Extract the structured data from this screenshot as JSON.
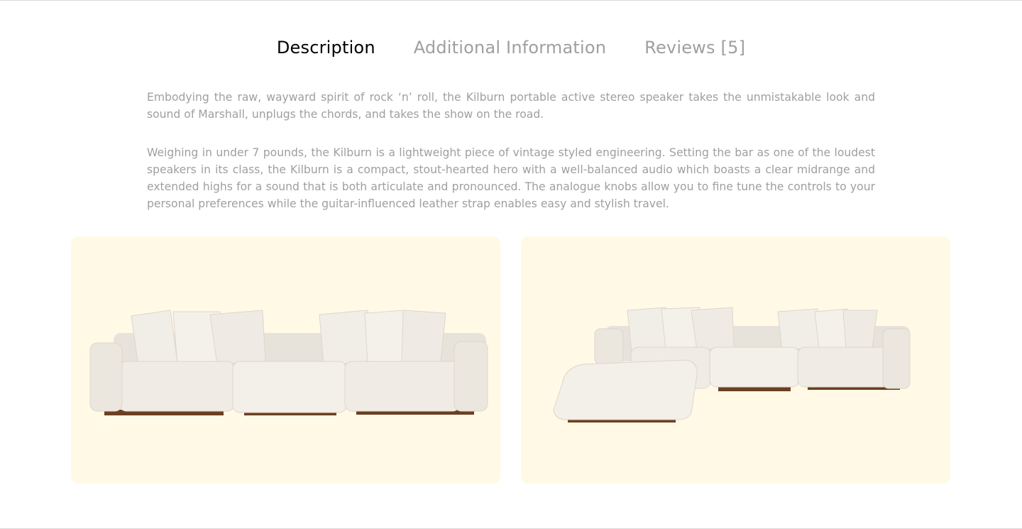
{
  "tabs": [
    {
      "label": "Description",
      "active": true
    },
    {
      "label": "Additional Information",
      "active": false
    },
    {
      "label": "Reviews [5]",
      "active": false
    }
  ],
  "description": {
    "paragraphs": [
      "Embodying the raw, wayward spirit of rock ‘n’ roll, the Kilburn portable active stereo speaker takes the unmistakable look and sound of Marshall, unplugs the chords, and takes the show on the road.",
      "Weighing in under 7 pounds, the Kilburn is a lightweight piece of vintage styled engineering. Setting the bar as one of the loudest speakers in its class, the Kilburn is a compact, stout-hearted hero with a well-balanced audio which boasts a clear midrange and extended highs for a sound that is both articulate and pronounced. The analogue knobs allow you to fine tune the controls to your personal preferences while the guitar-influenced leather strap enables easy and stylish travel."
    ]
  },
  "gallery": {
    "images": [
      {
        "name": "sofa-straight-image"
      },
      {
        "name": "sofa-sectional-image"
      }
    ]
  },
  "colors": {
    "active_tab": "#000000",
    "inactive_tab": "#9f9f9f",
    "body_text": "#9f9f9f",
    "card_background": "#fff9e6",
    "sofa_fabric": "#efebe4",
    "sofa_base": "#6b3f22"
  }
}
